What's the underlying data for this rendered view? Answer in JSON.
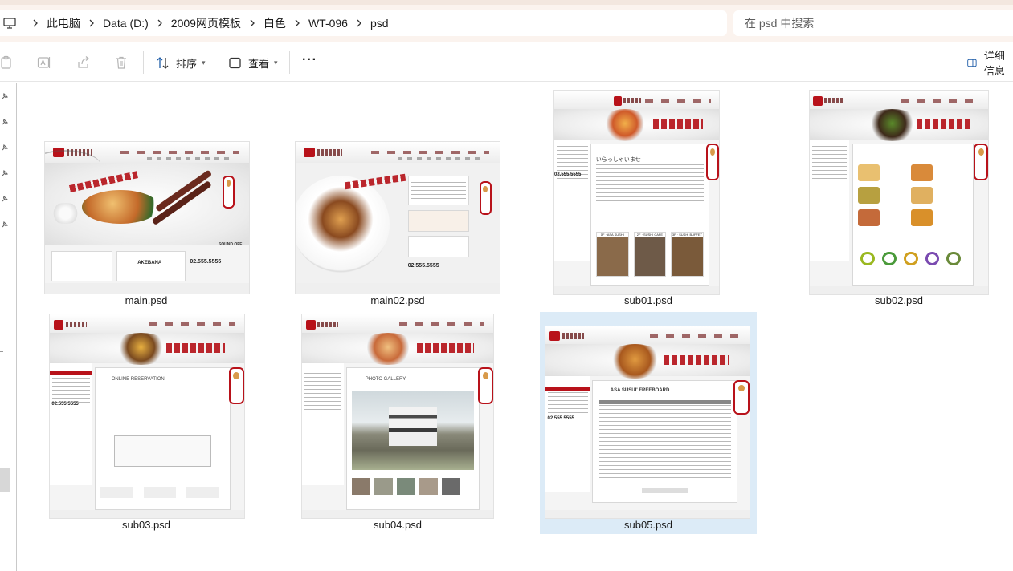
{
  "breadcrumb": {
    "items": [
      "此电脑",
      "Data (D:)",
      "2009网页模板",
      "白色",
      "WT-096",
      "psd"
    ]
  },
  "search": {
    "placeholder": "在 psd 中搜索"
  },
  "toolbar": {
    "sort_label": "排序",
    "view_label": "查看",
    "more_label": "···",
    "details_label": "详细信息"
  },
  "files": [
    {
      "name": "main.psd"
    },
    {
      "name": "main02.psd"
    },
    {
      "name": "sub01.psd"
    },
    {
      "name": "sub02.psd"
    },
    {
      "name": "sub03.psd"
    },
    {
      "name": "sub04.psd"
    },
    {
      "name": "sub05.psd",
      "selected": true
    }
  ],
  "thumb_text": {
    "phone": "02.555.5555",
    "akebana": "AKEBANA",
    "sound_off": "SOUND OFF",
    "reservation": "ONLINE RESERVATION",
    "gallery": "PHOTO GALLERY",
    "freeboard": "ASA SUSUI' FREEBOARD",
    "greeting": "いらっしゃいませ",
    "sushi1": "1F · ASA SUSHI",
    "sushi2": "2F · SUSHI CAFE",
    "sushi3": "3F · SUSHI BUFFET"
  },
  "colors": {
    "accent": "#b8121a",
    "selection": "#dcebf7",
    "address_bg": "#fbf3ee"
  }
}
